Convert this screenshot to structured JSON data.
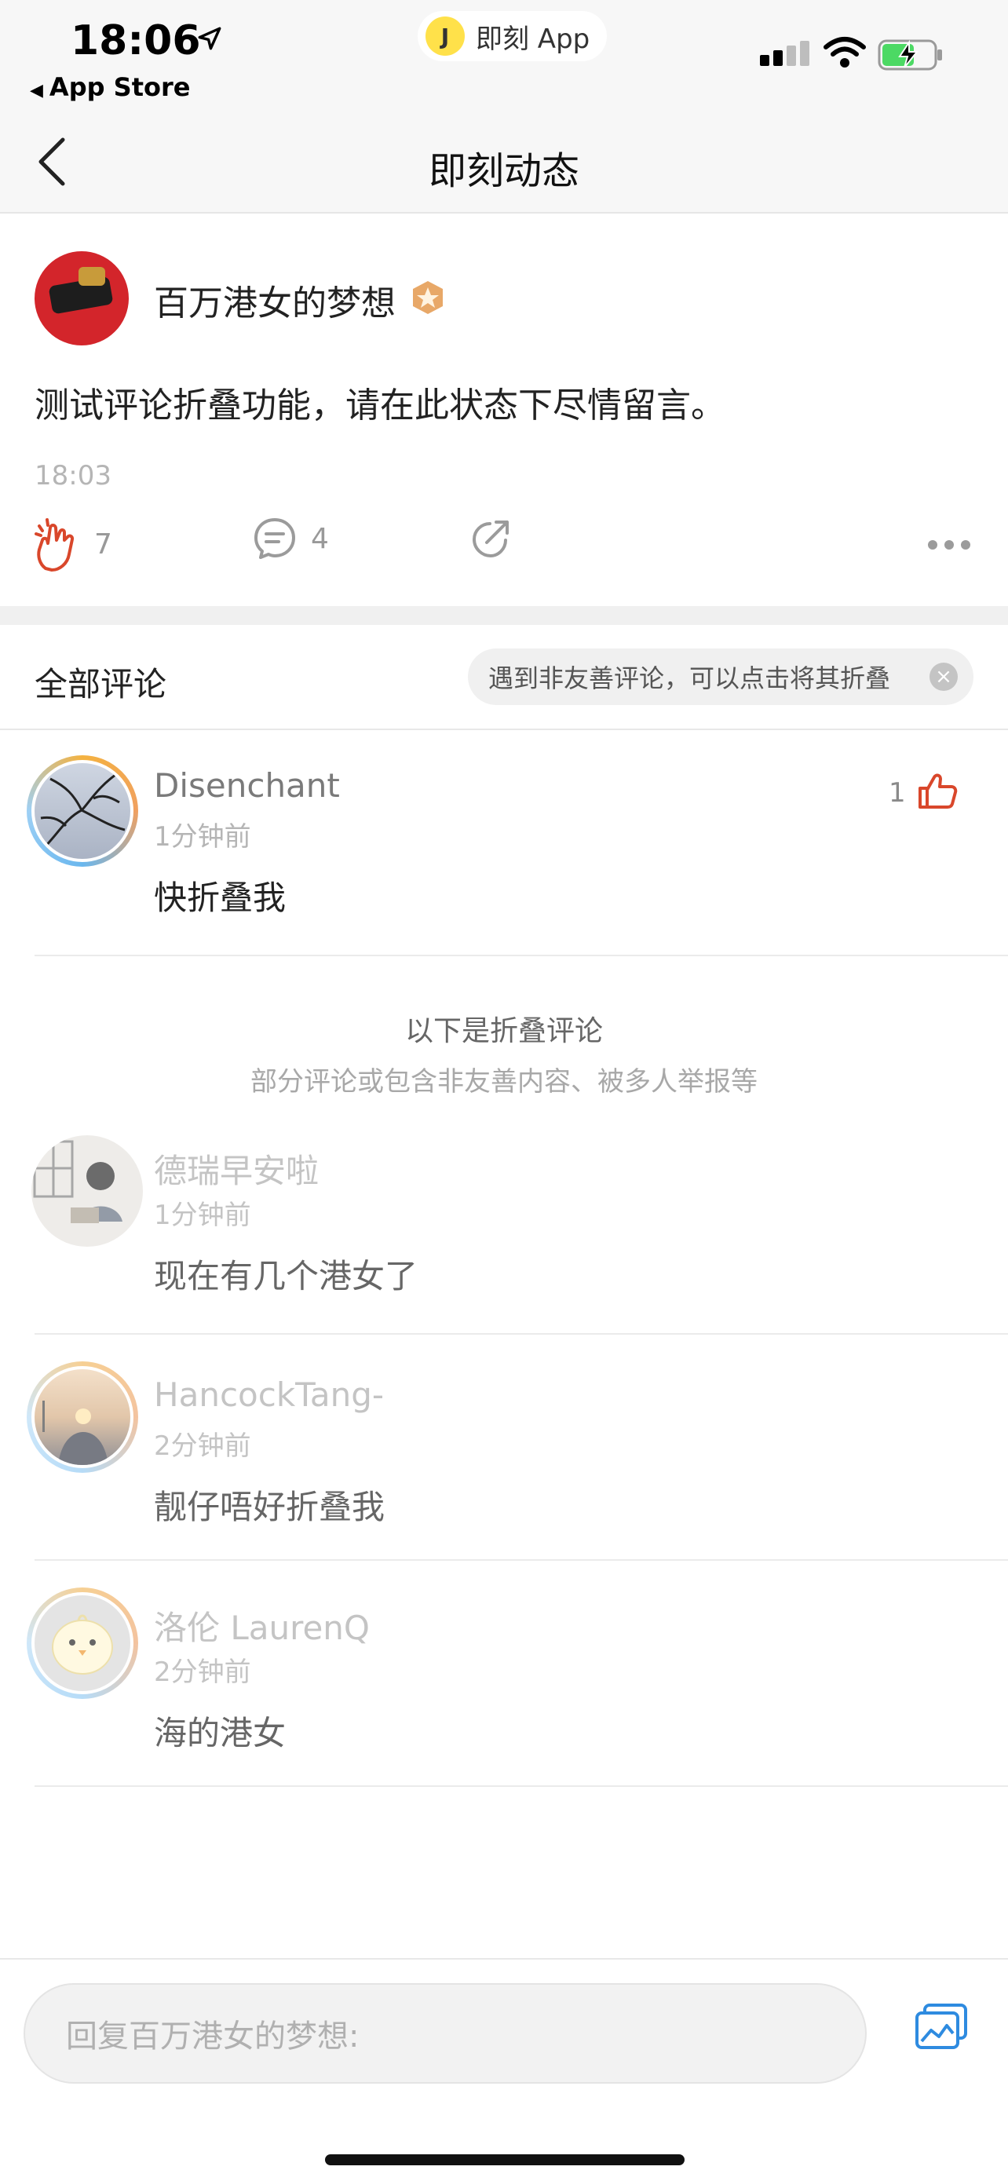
{
  "status_bar": {
    "time": "18:06",
    "back_app": "App Store",
    "pill_label": "即刻 App",
    "pill_logo": "J"
  },
  "nav": {
    "title": "即刻动态"
  },
  "post": {
    "author": "百万港女的梦想",
    "text": "测试评论折叠功能，请在此状态下尽情留言。",
    "time": "18:03",
    "like_count": "7",
    "comment_count": "4"
  },
  "comments_header": {
    "title": "全部评论",
    "hint": "遇到非友善评论，可以点击将其折叠",
    "close": "×"
  },
  "comments": [
    {
      "name": "Disenchant",
      "time": "1分钟前",
      "text": "快折叠我",
      "likes": "1"
    }
  ],
  "folded": {
    "title": "以下是折叠评论",
    "subtitle": "部分评论或包含非友善内容、被多人举报等",
    "items": [
      {
        "name": "德瑞早安啦",
        "time": "1分钟前",
        "text": "现在有几个港女了"
      },
      {
        "name": "HancockTang-",
        "time": "2分钟前",
        "text": "靓仔唔好折叠我"
      },
      {
        "name": "洛伦 LaurenQ",
        "time": "2分钟前",
        "text": "海的港女"
      }
    ]
  },
  "reply_bar": {
    "placeholder": "回复百万港女的梦想:"
  },
  "colors": {
    "accent": "#d9472b",
    "image_button": "#2e8be0"
  },
  "icons": [
    "location-arrow-icon",
    "signal-icon",
    "wifi-icon",
    "battery-icon",
    "back-chevron-icon",
    "badge-icon",
    "clap-like-icon",
    "comment-icon",
    "share-icon",
    "more-icon",
    "thumb-up-icon",
    "close-icon",
    "image-icon"
  ]
}
